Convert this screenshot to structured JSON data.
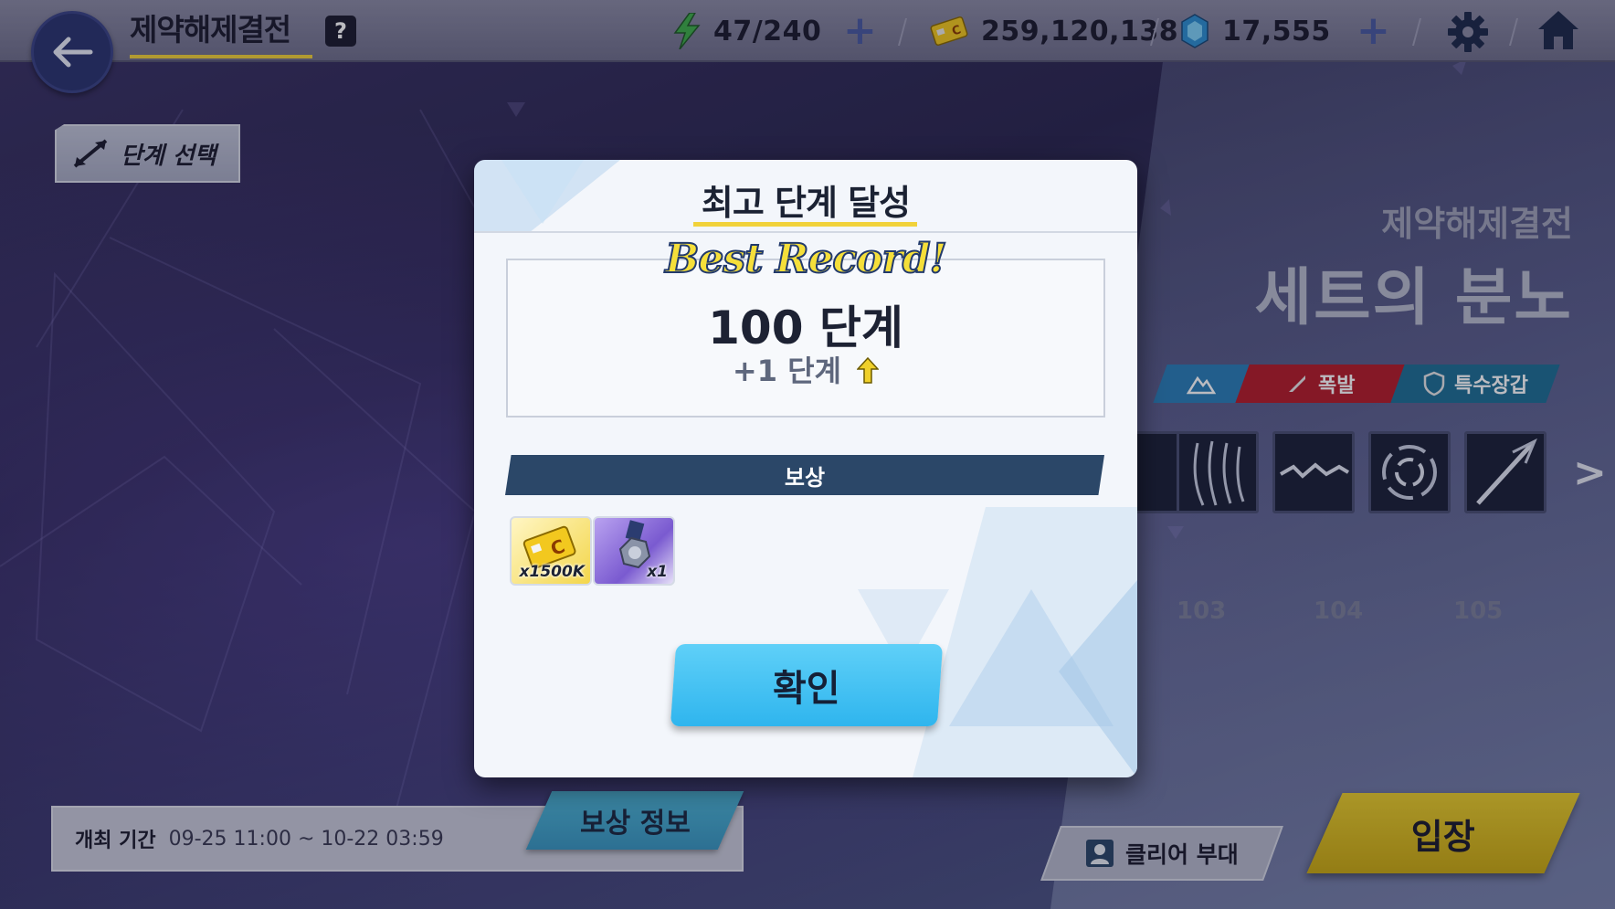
{
  "header": {
    "title": "제약해제결전",
    "help_label": "?",
    "stamina": "47/240",
    "credits": "259,120,138",
    "gems": "17,555"
  },
  "stage_select": {
    "label": "단계 선택"
  },
  "boss": {
    "subtitle": "제약해제결전",
    "name": "세트의 분노"
  },
  "tags": [
    {
      "label": "",
      "color": "#2c7fb8"
    },
    {
      "label": "폭발",
      "color": "#b51e2a"
    },
    {
      "label": "특수장갑",
      "color": "#1f6f95"
    }
  ],
  "lanes": [
    "103",
    "104",
    "105"
  ],
  "period": {
    "label": "개최 기간",
    "value": "09-25 11:00 ~ 10-22 03:59"
  },
  "reward_info_label": "보상 정보",
  "clear_team_label": "클리어 부대",
  "enter_label": "입장",
  "modal": {
    "title": "최고 단계 달성",
    "best_record": "Best Record!",
    "record_value": "100 단계",
    "record_diff": "+1 단계",
    "reward_header": "보상",
    "rewards": [
      {
        "name": "credit",
        "qty": "x1500K"
      },
      {
        "name": "medal",
        "qty": "x1"
      }
    ],
    "confirm_label": "확인"
  },
  "colors": {
    "accent_yellow": "#f1d23a",
    "confirm_blue": "#2fb5ee",
    "reward_bar": "#2b4768"
  }
}
